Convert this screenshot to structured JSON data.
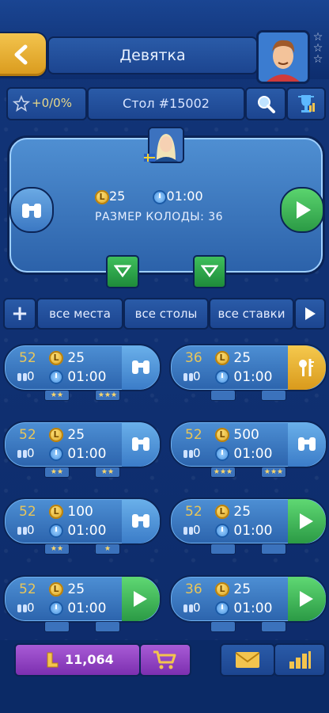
{
  "header": {
    "title": "Девятка",
    "back_icon": "chevron-left-icon",
    "profile_stars": [
      "☆",
      "☆",
      "☆"
    ]
  },
  "toolbar": {
    "rating": "+0/0%",
    "table_label": "Стол #15002",
    "search_icon": "magnifier-icon",
    "leaderboard_icon": "trophy-icon"
  },
  "featured_table": {
    "stake": "25",
    "time": "01:00",
    "deck_size": "РАЗМЕР КОЛОДЫ: 36",
    "coin_symbol": "L"
  },
  "filters": {
    "add": "+",
    "places": "все места",
    "tables": "все столы",
    "stakes": "все ставки"
  },
  "tables": [
    {
      "deck": "52",
      "watchers": "0",
      "stake": "25",
      "time": "01:00",
      "action": "binoculars",
      "tags_below": [
        "★★",
        "★★★"
      ]
    },
    {
      "deck": "36",
      "watchers": "0",
      "stake": "25",
      "time": "01:00",
      "action": "key",
      "tags_below": [
        "",
        ""
      ]
    },
    {
      "deck": "52",
      "watchers": "0",
      "stake": "25",
      "time": "01:00",
      "action": "binoculars",
      "tags_below": [
        "★★",
        "★★"
      ]
    },
    {
      "deck": "52",
      "watchers": "0",
      "stake": "500",
      "time": "01:00",
      "action": "binoculars",
      "tags_below": [
        "★★★",
        "★★★"
      ]
    },
    {
      "deck": "52",
      "watchers": "0",
      "stake": "100",
      "time": "01:00",
      "action": "binoculars",
      "tags_below": [
        "★★",
        "★"
      ]
    },
    {
      "deck": "52",
      "watchers": "0",
      "stake": "25",
      "time": "01:00",
      "action": "play",
      "tags_below": [
        "",
        ""
      ]
    },
    {
      "deck": "52",
      "watchers": "0",
      "stake": "25",
      "time": "01:00",
      "action": "play",
      "tags_below": [
        "",
        ""
      ]
    },
    {
      "deck": "36",
      "watchers": "0",
      "stake": "25",
      "time": "01:00",
      "action": "play",
      "tags_below": [
        "",
        ""
      ]
    }
  ],
  "footer": {
    "balance": "11,064",
    "balance_symbol": "L"
  },
  "colors": {
    "background": "#0f2f72",
    "panel": "#2c64ad",
    "accent_gold": "#f3c44e",
    "play_green": "#2b9a45",
    "purple": "#7c2fb0"
  }
}
